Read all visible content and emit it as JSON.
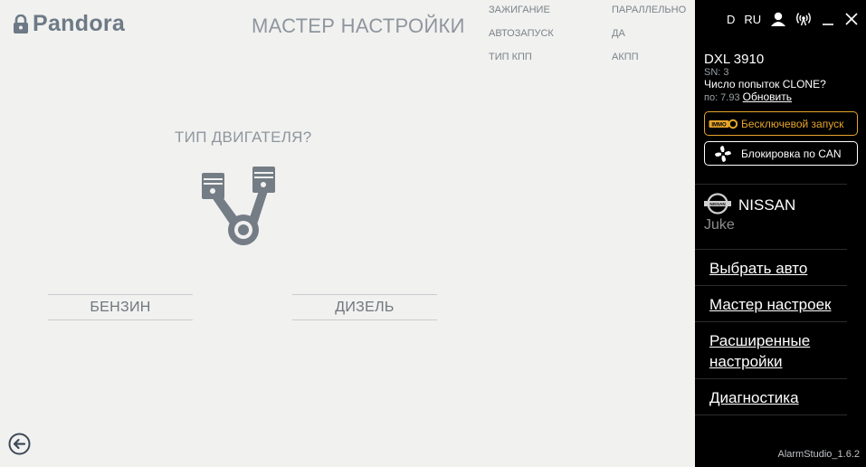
{
  "brand": {
    "name": "Pandora"
  },
  "wizard": {
    "title": "МАСТЕР НАСТРОЙКИ"
  },
  "summary": {
    "labels": [
      "ЗАЖИГАНИЕ",
      "АВТОЗАПУСК",
      "ТИП КПП"
    ],
    "values": [
      "ПАРАЛЛЕЛЬНО",
      "ДА",
      "АКПП"
    ]
  },
  "question": "ТИП ДВИГАТЕЛЯ?",
  "choices": {
    "petrol": "БЕНЗИН",
    "diesel": "ДИЗЕЛЬ"
  },
  "topbar": {
    "d_label": "D",
    "lang": "RU"
  },
  "device": {
    "model": "DXL 3910",
    "sn": "SN: 3",
    "clone_text": "Число попыток CLONE?",
    "version_prefix": "по: 7.93",
    "update_link": "Обновить"
  },
  "buttons": {
    "keyless": "Бесключевой запуск",
    "can_block": "Блокировка по CAN"
  },
  "car": {
    "make": "NISSAN",
    "model": "Juke",
    "badge_text": "NISSAN"
  },
  "menu": [
    {
      "label": "Выбрать авто"
    },
    {
      "label": "Мастер настроек"
    },
    {
      "label": "Расширенные"
    },
    {
      "label": "настройки"
    },
    {
      "label": "Диагностика"
    }
  ],
  "app_version": "AlarmStudio_1.6.2",
  "colors": {
    "accent_orange": "#e7a52b",
    "sidebar_bg": "#000000",
    "main_bg": "#f1f1f0"
  }
}
